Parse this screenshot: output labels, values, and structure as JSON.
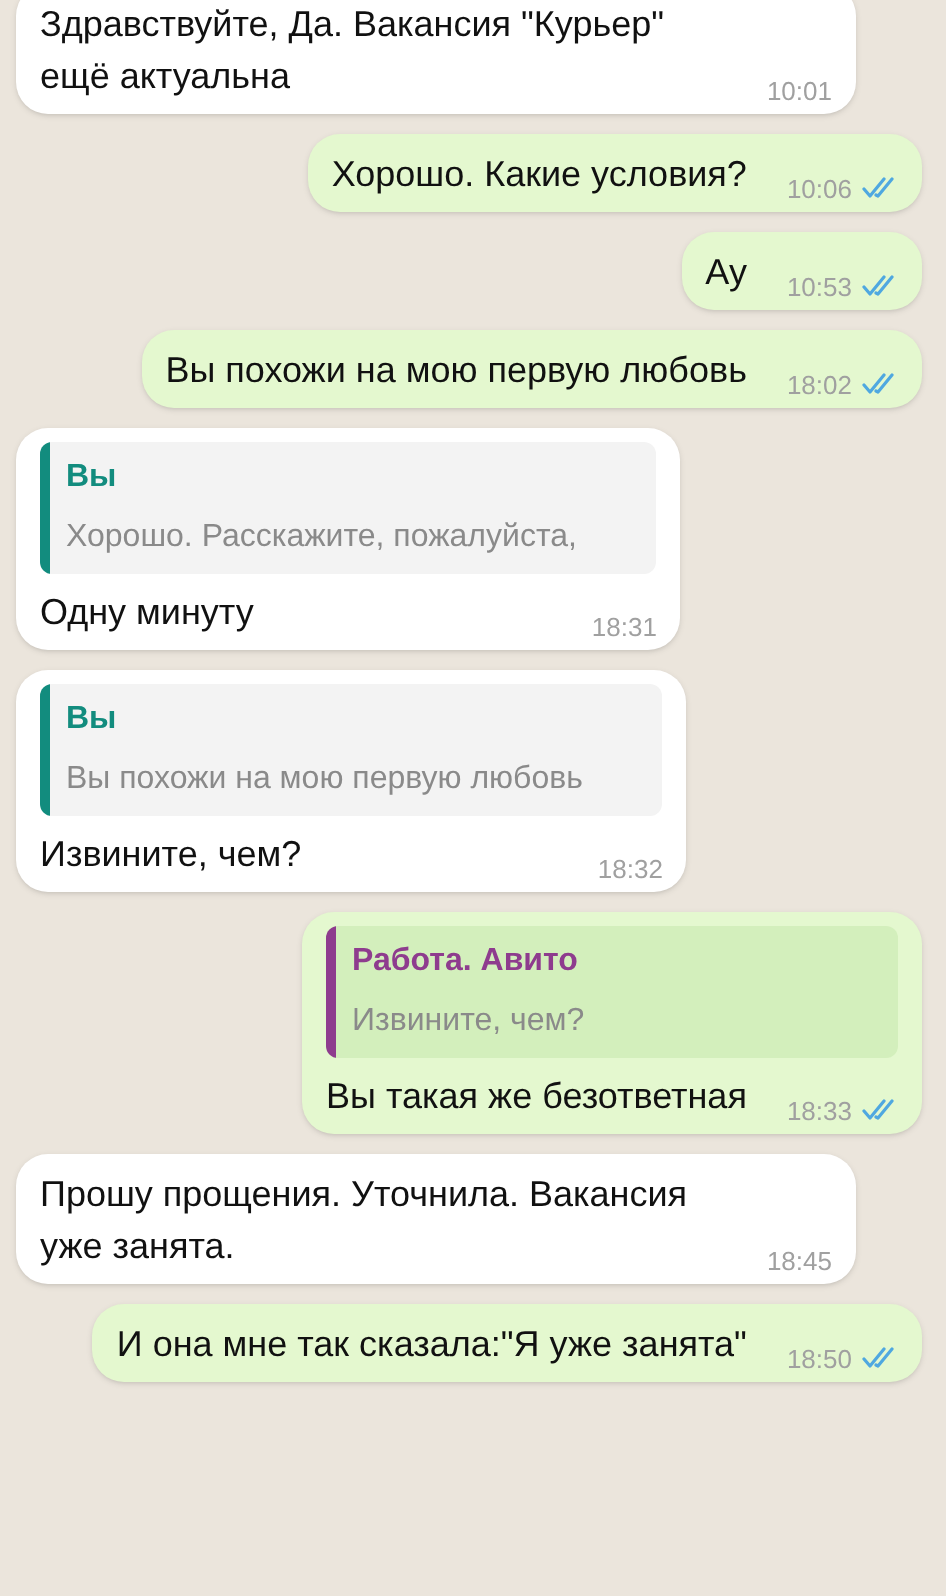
{
  "messages": [
    {
      "kind": "incoming",
      "text": "Здравствуйте, Да. Вакансия \"Курьер\" ещё актуальна",
      "time": "10:01"
    },
    {
      "kind": "outgoing",
      "text": "Хорошо. Какие условия?",
      "time": "10:06",
      "read": true
    },
    {
      "kind": "outgoing",
      "text": "Ау",
      "time": "10:53",
      "read": true
    },
    {
      "kind": "outgoing",
      "text": "Вы похожи на мою первую любовь",
      "time": "18:02",
      "read": true
    },
    {
      "kind": "incoming",
      "quote": {
        "author": "Вы",
        "color": "#128c7e",
        "text": "Хорошо. Расскажите, пожалуйста,"
      },
      "text": "Одну минуту",
      "time": "18:31"
    },
    {
      "kind": "incoming",
      "quote": {
        "author": "Вы",
        "color": "#128c7e",
        "text": "Вы похожи на мою первую любовь"
      },
      "text": "Извините, чем?",
      "time": "18:32"
    },
    {
      "kind": "outgoing",
      "quote": {
        "author": "Работа. Авито",
        "color": "#8e3c8e",
        "text": "Извините, чем?"
      },
      "text": "Вы такая же безответная",
      "time": "18:33",
      "read": true
    },
    {
      "kind": "incoming",
      "text": "Прошу прощения. Уточнила. Вакансия уже занята.",
      "time": "18:45"
    },
    {
      "kind": "outgoing",
      "text": "И она мне так сказала:\"Я уже занята\"",
      "time": "18:50",
      "read": true
    }
  ]
}
